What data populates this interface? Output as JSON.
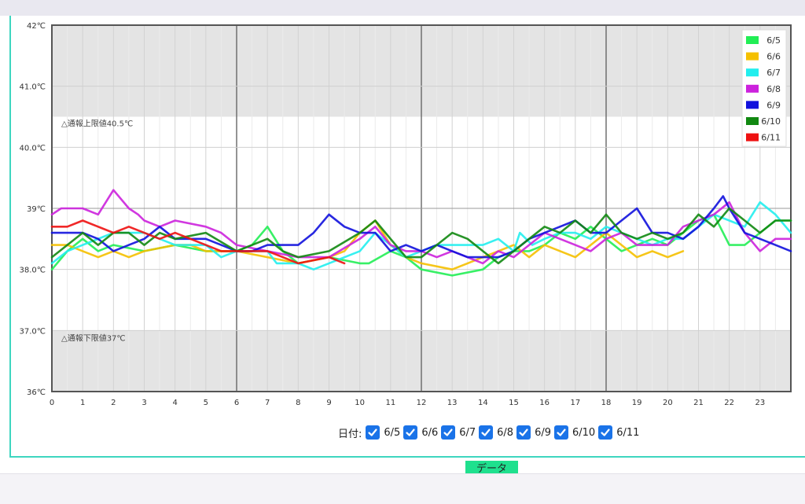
{
  "chart_data": {
    "type": "line",
    "x_label": "",
    "y_label": "",
    "x_range": [
      0,
      24
    ],
    "y_range": [
      36,
      42
    ],
    "x_ticks": [
      "0",
      "1",
      "2",
      "3",
      "4",
      "5",
      "6",
      "7",
      "8",
      "9",
      "10",
      "11",
      "12",
      "13",
      "14",
      "15",
      "16",
      "17",
      "18",
      "19",
      "20",
      "21",
      "22",
      "23"
    ],
    "y_ticks": [
      {
        "value": 36,
        "label": "36℃"
      },
      {
        "value": 37,
        "label": "37.0℃"
      },
      {
        "value": 38,
        "label": "38.0℃"
      },
      {
        "value": 39,
        "label": "39℃"
      },
      {
        "value": 40,
        "label": "40.0℃"
      },
      {
        "value": 41,
        "label": "41.0℃"
      },
      {
        "value": 42,
        "label": "42℃"
      }
    ],
    "upper_limit": {
      "value": 40.5,
      "label": "△通報上限値40.5℃"
    },
    "lower_limit": {
      "value": 37,
      "label": "△通報下限値37℃"
    },
    "legend_position": "top-right",
    "grid": true,
    "series": [
      {
        "name": "6/5",
        "color": "#22ee55",
        "points": [
          [
            0,
            38.0
          ],
          [
            0.5,
            38.3
          ],
          [
            1,
            38.5
          ],
          [
            1.5,
            38.3
          ],
          [
            2,
            38.4
          ],
          [
            3,
            38.3
          ],
          [
            4,
            38.4
          ],
          [
            5,
            38.3
          ],
          [
            6,
            38.3
          ],
          [
            6.5,
            38.4
          ],
          [
            7,
            38.7
          ],
          [
            7.5,
            38.3
          ],
          [
            8,
            38.1
          ],
          [
            9,
            38.2
          ],
          [
            10,
            38.1
          ],
          [
            10.3,
            38.1
          ],
          [
            11,
            38.3
          ],
          [
            11.5,
            38.2
          ],
          [
            12,
            38.0
          ],
          [
            13,
            37.9
          ],
          [
            14,
            38.0
          ],
          [
            14.5,
            38.2
          ],
          [
            15,
            38.3
          ],
          [
            15.5,
            38.3
          ],
          [
            16,
            38.4
          ],
          [
            16.5,
            38.6
          ],
          [
            17,
            38.5
          ],
          [
            17.5,
            38.7
          ],
          [
            18,
            38.5
          ],
          [
            18.5,
            38.3
          ],
          [
            19,
            38.4
          ],
          [
            19.5,
            38.5
          ],
          [
            20,
            38.4
          ],
          [
            20.5,
            38.6
          ],
          [
            21,
            38.8
          ],
          [
            21.5,
            38.9
          ],
          [
            22,
            38.4
          ],
          [
            22.5,
            38.4
          ],
          [
            23,
            38.6
          ],
          [
            23.5,
            38.8
          ],
          [
            24,
            38.8
          ]
        ]
      },
      {
        "name": "6/6",
        "color": "#f5c000",
        "points": [
          [
            0,
            38.4
          ],
          [
            0.5,
            38.4
          ],
          [
            1,
            38.3
          ],
          [
            1.5,
            38.2
          ],
          [
            2,
            38.3
          ],
          [
            2.5,
            38.2
          ],
          [
            3,
            38.3
          ],
          [
            4,
            38.4
          ],
          [
            4.5,
            38.4
          ],
          [
            5,
            38.3
          ],
          [
            6,
            38.3
          ],
          [
            7,
            38.2
          ],
          [
            8,
            38.1
          ],
          [
            9,
            38.2
          ],
          [
            9.5,
            38.3
          ],
          [
            10,
            38.6
          ],
          [
            10.5,
            38.8
          ],
          [
            11,
            38.4
          ],
          [
            11.5,
            38.2
          ],
          [
            12,
            38.1
          ],
          [
            13,
            38.0
          ],
          [
            13.5,
            38.1
          ],
          [
            14,
            38.2
          ],
          [
            14.5,
            38.3
          ],
          [
            15,
            38.4
          ],
          [
            15.5,
            38.2
          ],
          [
            16,
            38.4
          ],
          [
            17,
            38.2
          ],
          [
            17.5,
            38.4
          ],
          [
            18,
            38.6
          ],
          [
            18.5,
            38.4
          ],
          [
            19,
            38.2
          ],
          [
            19.5,
            38.3
          ],
          [
            20,
            38.2
          ],
          [
            20.5,
            38.3
          ]
        ]
      },
      {
        "name": "6/7",
        "color": "#22eeee",
        "points": [
          [
            0,
            38.1
          ],
          [
            0.5,
            38.3
          ],
          [
            1,
            38.4
          ],
          [
            2,
            38.6
          ],
          [
            3,
            38.6
          ],
          [
            4,
            38.4
          ],
          [
            5,
            38.4
          ],
          [
            5.5,
            38.2
          ],
          [
            6,
            38.3
          ],
          [
            7,
            38.3
          ],
          [
            7.3,
            38.1
          ],
          [
            8,
            38.1
          ],
          [
            8.5,
            38.0
          ],
          [
            9,
            38.1
          ],
          [
            10,
            38.3
          ],
          [
            10.5,
            38.6
          ],
          [
            11,
            38.4
          ],
          [
            11.5,
            38.2
          ],
          [
            12,
            38.3
          ],
          [
            12.5,
            38.4
          ],
          [
            13,
            38.4
          ],
          [
            14,
            38.4
          ],
          [
            14.5,
            38.5
          ],
          [
            15,
            38.3
          ],
          [
            15.2,
            38.6
          ],
          [
            15.6,
            38.4
          ],
          [
            16,
            38.5
          ],
          [
            16.5,
            38.6
          ],
          [
            17,
            38.6
          ],
          [
            17.5,
            38.5
          ],
          [
            18,
            38.7
          ],
          [
            19,
            38.5
          ],
          [
            19.5,
            38.4
          ],
          [
            20,
            38.5
          ],
          [
            20.5,
            38.5
          ],
          [
            21,
            38.7
          ],
          [
            21.5,
            38.9
          ],
          [
            22,
            38.8
          ],
          [
            22.5,
            38.7
          ],
          [
            23,
            39.1
          ],
          [
            23.5,
            38.9
          ],
          [
            24,
            38.6
          ]
        ]
      },
      {
        "name": "6/8",
        "color": "#cc22dd",
        "points": [
          [
            0,
            38.9
          ],
          [
            0.3,
            39.0
          ],
          [
            1,
            39.0
          ],
          [
            1.5,
            38.9
          ],
          [
            2,
            39.3
          ],
          [
            2.5,
            39.0
          ],
          [
            2.8,
            38.9
          ],
          [
            3,
            38.8
          ],
          [
            3.5,
            38.7
          ],
          [
            4,
            38.8
          ],
          [
            5,
            38.7
          ],
          [
            5.5,
            38.6
          ],
          [
            6,
            38.4
          ],
          [
            7,
            38.3
          ],
          [
            8,
            38.2
          ],
          [
            9,
            38.2
          ],
          [
            10,
            38.5
          ],
          [
            10.5,
            38.7
          ],
          [
            11,
            38.4
          ],
          [
            11.5,
            38.3
          ],
          [
            12,
            38.3
          ],
          [
            12.5,
            38.2
          ],
          [
            13,
            38.3
          ],
          [
            14,
            38.1
          ],
          [
            14.5,
            38.3
          ],
          [
            15,
            38.2
          ],
          [
            15.5,
            38.4
          ],
          [
            16,
            38.6
          ],
          [
            16.5,
            38.5
          ],
          [
            17,
            38.4
          ],
          [
            17.5,
            38.3
          ],
          [
            18,
            38.5
          ],
          [
            18.5,
            38.6
          ],
          [
            19,
            38.4
          ],
          [
            19.5,
            38.4
          ],
          [
            20,
            38.4
          ],
          [
            20.5,
            38.7
          ],
          [
            21,
            38.8
          ],
          [
            21.5,
            38.9
          ],
          [
            22,
            39.1
          ],
          [
            22.5,
            38.6
          ],
          [
            23,
            38.3
          ],
          [
            23.5,
            38.5
          ],
          [
            24,
            38.5
          ]
        ]
      },
      {
        "name": "6/9",
        "color": "#1111dd",
        "points": [
          [
            0,
            38.6
          ],
          [
            1,
            38.6
          ],
          [
            1.5,
            38.5
          ],
          [
            2,
            38.3
          ],
          [
            2.5,
            38.4
          ],
          [
            3,
            38.5
          ],
          [
            3.5,
            38.7
          ],
          [
            4,
            38.5
          ],
          [
            5,
            38.5
          ],
          [
            5.5,
            38.4
          ],
          [
            6,
            38.3
          ],
          [
            6.5,
            38.3
          ],
          [
            7,
            38.4
          ],
          [
            8,
            38.4
          ],
          [
            8.5,
            38.6
          ],
          [
            9,
            38.9
          ],
          [
            9.5,
            38.7
          ],
          [
            10,
            38.6
          ],
          [
            10.5,
            38.6
          ],
          [
            11,
            38.3
          ],
          [
            11.5,
            38.4
          ],
          [
            12,
            38.3
          ],
          [
            12.5,
            38.4
          ],
          [
            13,
            38.3
          ],
          [
            13.5,
            38.2
          ],
          [
            14,
            38.2
          ],
          [
            14.5,
            38.2
          ],
          [
            15,
            38.3
          ],
          [
            15.5,
            38.5
          ],
          [
            16,
            38.6
          ],
          [
            16.5,
            38.7
          ],
          [
            17,
            38.8
          ],
          [
            17.5,
            38.6
          ],
          [
            18,
            38.6
          ],
          [
            18.5,
            38.8
          ],
          [
            19,
            39.0
          ],
          [
            19.5,
            38.6
          ],
          [
            20,
            38.6
          ],
          [
            20.5,
            38.5
          ],
          [
            21,
            38.7
          ],
          [
            21.5,
            39.0
          ],
          [
            21.8,
            39.2
          ],
          [
            22,
            39.0
          ],
          [
            22.5,
            38.6
          ],
          [
            23,
            38.5
          ],
          [
            23.5,
            38.4
          ],
          [
            24,
            38.3
          ]
        ]
      },
      {
        "name": "6/10",
        "color": "#118811",
        "points": [
          [
            0,
            38.2
          ],
          [
            0.5,
            38.4
          ],
          [
            1,
            38.6
          ],
          [
            1.5,
            38.4
          ],
          [
            2,
            38.6
          ],
          [
            2.5,
            38.6
          ],
          [
            3,
            38.4
          ],
          [
            3.5,
            38.6
          ],
          [
            4,
            38.5
          ],
          [
            5,
            38.6
          ],
          [
            6,
            38.3
          ],
          [
            7,
            38.5
          ],
          [
            7.5,
            38.3
          ],
          [
            8,
            38.2
          ],
          [
            9,
            38.3
          ],
          [
            10,
            38.6
          ],
          [
            10.5,
            38.8
          ],
          [
            11,
            38.5
          ],
          [
            11.5,
            38.2
          ],
          [
            12,
            38.2
          ],
          [
            12.5,
            38.4
          ],
          [
            13,
            38.6
          ],
          [
            13.5,
            38.5
          ],
          [
            14,
            38.3
          ],
          [
            14.5,
            38.1
          ],
          [
            15,
            38.3
          ],
          [
            15.5,
            38.5
          ],
          [
            16,
            38.7
          ],
          [
            16.5,
            38.6
          ],
          [
            17,
            38.8
          ],
          [
            17.5,
            38.6
          ],
          [
            18,
            38.9
          ],
          [
            18.5,
            38.6
          ],
          [
            19,
            38.5
          ],
          [
            19.5,
            38.6
          ],
          [
            20,
            38.5
          ],
          [
            20.5,
            38.6
          ],
          [
            21,
            38.9
          ],
          [
            21.5,
            38.7
          ],
          [
            22,
            39.0
          ],
          [
            22.5,
            38.8
          ],
          [
            23,
            38.6
          ],
          [
            23.5,
            38.8
          ],
          [
            24,
            38.8
          ]
        ]
      },
      {
        "name": "6/11",
        "color": "#ee1111",
        "points": [
          [
            0,
            38.7
          ],
          [
            0.5,
            38.7
          ],
          [
            1,
            38.8
          ],
          [
            1.5,
            38.7
          ],
          [
            2,
            38.6
          ],
          [
            2.5,
            38.7
          ],
          [
            3,
            38.6
          ],
          [
            3.5,
            38.5
          ],
          [
            4,
            38.6
          ],
          [
            5,
            38.4
          ],
          [
            5.5,
            38.3
          ],
          [
            6,
            38.3
          ],
          [
            6.5,
            38.3
          ],
          [
            7,
            38.3
          ],
          [
            7.5,
            38.2
          ],
          [
            8,
            38.1
          ],
          [
            9,
            38.2
          ],
          [
            9.5,
            38.1
          ]
        ]
      }
    ]
  },
  "filters": {
    "label": "日付:",
    "items": [
      {
        "label": "6/5"
      },
      {
        "label": "6/6"
      },
      {
        "label": "6/7"
      },
      {
        "label": "6/8"
      },
      {
        "label": "6/9"
      },
      {
        "label": "6/10"
      },
      {
        "label": "6/11"
      }
    ]
  },
  "data_button": {
    "label": "データ"
  }
}
